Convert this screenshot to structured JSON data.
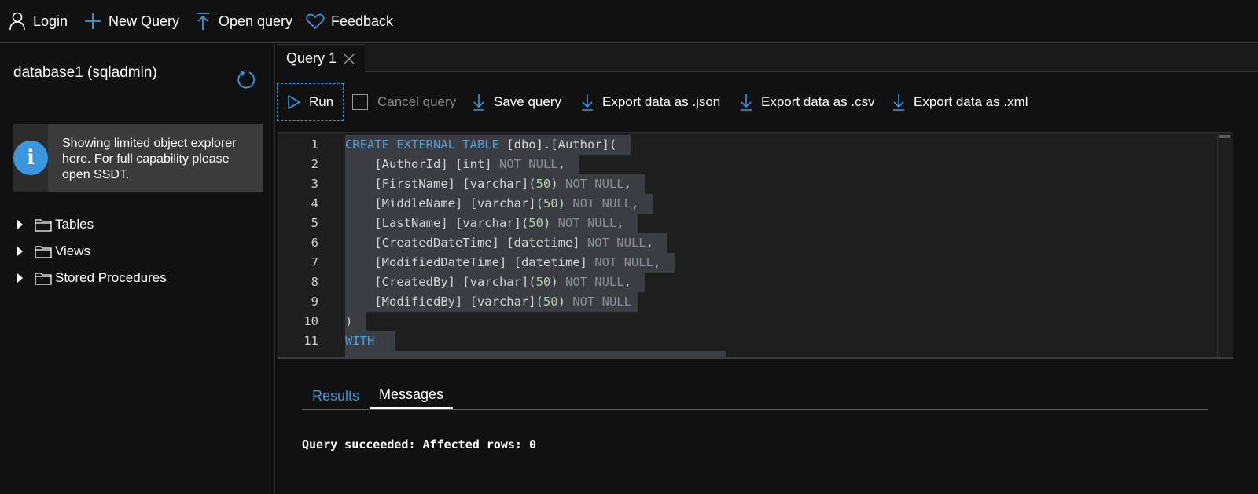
{
  "toolbar": {
    "login": "Login",
    "new_query": "New Query",
    "open_query": "Open query",
    "feedback": "Feedback",
    "icons": [
      "person-icon",
      "plus-icon",
      "upload-icon",
      "heart-icon"
    ]
  },
  "sidebar": {
    "db_title": "database1 (sqladmin)",
    "info_text": "Showing limited object explorer here. For full capability please open SSDT.",
    "items": [
      {
        "label": "Tables"
      },
      {
        "label": "Views"
      },
      {
        "label": "Stored Procedures"
      }
    ]
  },
  "tabs": [
    {
      "label": "Query 1"
    }
  ],
  "query_toolbar": {
    "run": "Run",
    "cancel": "Cancel query",
    "save": "Save query",
    "export_json": "Export data as .json",
    "export_csv": "Export data as .csv",
    "export_xml": "Export data as .xml"
  },
  "editor": {
    "line_numbers": [
      "1",
      "2",
      "3",
      "4",
      "5",
      "6",
      "7",
      "8",
      "9",
      "10",
      "11"
    ]
  },
  "results": {
    "tab_results": "Results",
    "tab_messages": "Messages",
    "message": "Query succeeded: Affected rows: 0"
  },
  "colors": {
    "accent": "#3a96dd",
    "keyword": "#569cd6",
    "selection": "#3a3d41"
  }
}
